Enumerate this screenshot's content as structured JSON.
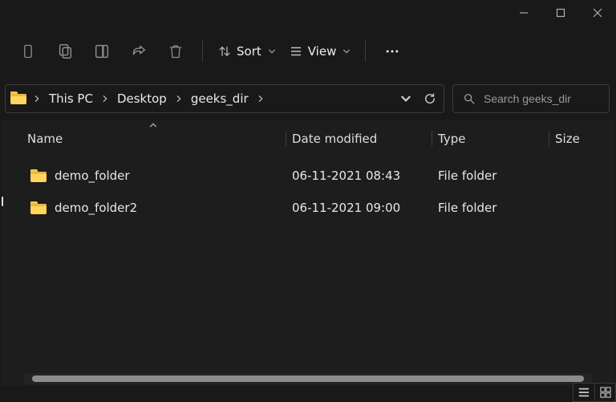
{
  "window": {
    "title": ""
  },
  "toolbar": {
    "sort_label": "Sort",
    "view_label": "View"
  },
  "breadcrumb": {
    "items": [
      "This PC",
      "Desktop",
      "geeks_dir"
    ]
  },
  "search": {
    "placeholder": "Search geeks_dir"
  },
  "columns": {
    "name": "Name",
    "date_modified": "Date modified",
    "type": "Type",
    "size": "Size"
  },
  "files": [
    {
      "name": "demo_folder",
      "date_modified": "06-11-2021 08:43",
      "type": "File folder",
      "size": ""
    },
    {
      "name": "demo_folder2",
      "date_modified": "06-11-2021 09:00",
      "type": "File folder",
      "size": ""
    }
  ]
}
